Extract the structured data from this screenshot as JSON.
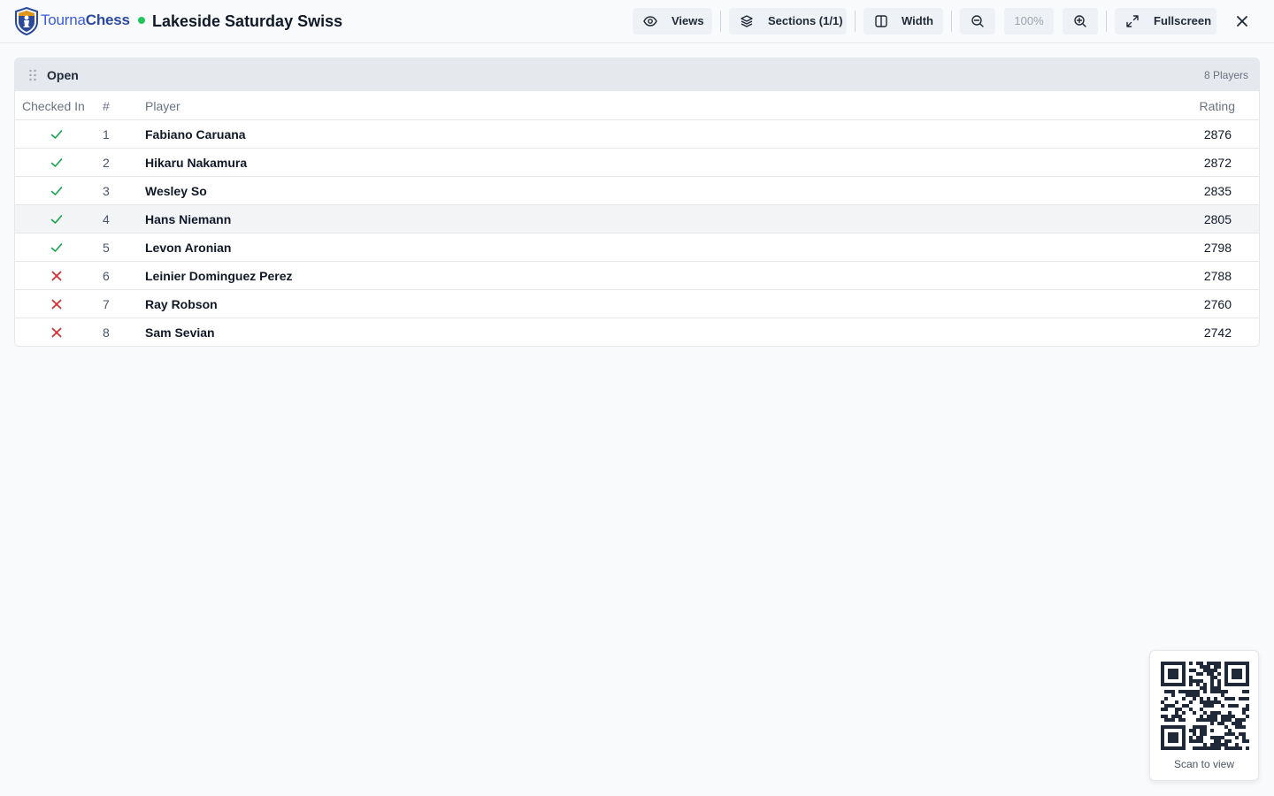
{
  "header": {
    "brand_part1": "Tourna",
    "brand_part2": "Chess",
    "event_title": "Lakeside Saturday Swiss",
    "live_status_color": "#22c55e",
    "buttons": {
      "views": "Views",
      "sections": "Sections (1/1)",
      "width": "Width",
      "zoom_level": "100%",
      "fullscreen": "Fullscreen"
    },
    "icons": [
      "eye-icon",
      "layers-icon",
      "columns-icon",
      "zoom-out-icon",
      "zoom-in-icon",
      "expand-icon",
      "close-icon"
    ]
  },
  "section": {
    "name": "Open",
    "player_count": "8 Players",
    "columns": {
      "checked_in": "Checked In",
      "number": "#",
      "player": "Player",
      "rating": "Rating"
    },
    "rows": [
      {
        "checked_in": true,
        "number": "1",
        "player": "Fabiano Caruana",
        "rating": "2876"
      },
      {
        "checked_in": true,
        "number": "2",
        "player": "Hikaru Nakamura",
        "rating": "2872"
      },
      {
        "checked_in": true,
        "number": "3",
        "player": "Wesley So",
        "rating": "2835"
      },
      {
        "checked_in": true,
        "number": "4",
        "player": "Hans Niemann",
        "rating": "2805"
      },
      {
        "checked_in": true,
        "number": "5",
        "player": "Levon Aronian",
        "rating": "2798"
      },
      {
        "checked_in": false,
        "number": "6",
        "player": "Leinier Dominguez Perez",
        "rating": "2788"
      },
      {
        "checked_in": false,
        "number": "7",
        "player": "Ray Robson",
        "rating": "2760"
      },
      {
        "checked_in": false,
        "number": "8",
        "player": "Sam Sevian",
        "rating": "2742"
      }
    ],
    "highlighted_row": "4",
    "status_colors": {
      "checked": "#16a34a",
      "unchecked": "#dc2626"
    }
  },
  "qr": {
    "caption": "Scan to view",
    "icon": "qr-code-icon"
  }
}
